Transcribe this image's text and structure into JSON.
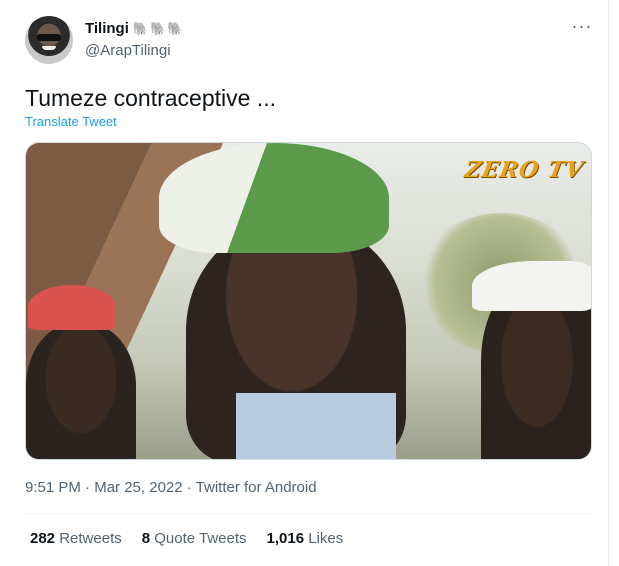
{
  "author": {
    "display_name": "Tilingi",
    "name_emoji": "🐘🐘🐘",
    "handle": "@ArapTilingi"
  },
  "tweet": {
    "text": "Tumeze contraceptive ...",
    "translate_label": "Translate Tweet",
    "media_watermark": "ZERO TV"
  },
  "meta": {
    "time": "9:51 PM",
    "date": "Mar 25, 2022",
    "source": "Twitter for Android",
    "separator": " · "
  },
  "stats": [
    {
      "count": "282",
      "label": "Retweets"
    },
    {
      "count": "8",
      "label": "Quote Tweets"
    },
    {
      "count": "1,016",
      "label": "Likes"
    }
  ],
  "icons": {
    "more": "more-horizontal-icon"
  }
}
